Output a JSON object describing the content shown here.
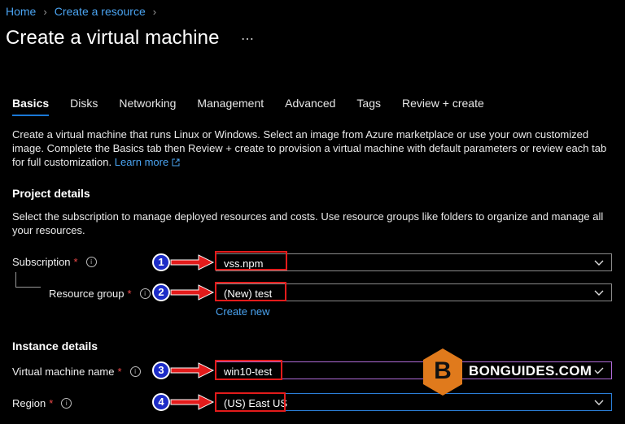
{
  "breadcrumb": {
    "home": "Home",
    "create_resource": "Create a resource"
  },
  "page": {
    "title": "Create a virtual machine",
    "more": "⋯"
  },
  "tabs": [
    {
      "label": "Basics"
    },
    {
      "label": "Disks"
    },
    {
      "label": "Networking"
    },
    {
      "label": "Management"
    },
    {
      "label": "Advanced"
    },
    {
      "label": "Tags"
    },
    {
      "label": "Review + create"
    }
  ],
  "intro": {
    "text": "Create a virtual machine that runs Linux or Windows. Select an image from Azure marketplace or use your own customized image. Complete the Basics tab then Review + create to provision a virtual machine with default parameters or review each tab for full customization.",
    "link": "Learn more"
  },
  "project": {
    "title": "Project details",
    "desc": "Select the subscription to manage deployed resources and costs. Use resource groups like folders to organize and manage all your resources.",
    "subscription_label": "Subscription",
    "subscription_value": "vss.npm",
    "rg_label": "Resource group",
    "rg_value": "(New) test",
    "create_new": "Create new"
  },
  "instance": {
    "title": "Instance details",
    "vm_name_label": "Virtual machine name",
    "vm_name_value": "win10-test",
    "region_label": "Region",
    "region_value": "(US) East US"
  },
  "common": {
    "required": "*",
    "info": "i"
  },
  "callouts": [
    "1",
    "2",
    "3",
    "4"
  ],
  "watermark": {
    "text": "BONGUIDES.COM",
    "logo_letter": "B"
  },
  "colors": {
    "accent": "#1a78d6",
    "link": "#4aa3f0",
    "highlight": "#e31b1b",
    "badge": "#1c2cc7",
    "logo": "#e07a1c"
  }
}
